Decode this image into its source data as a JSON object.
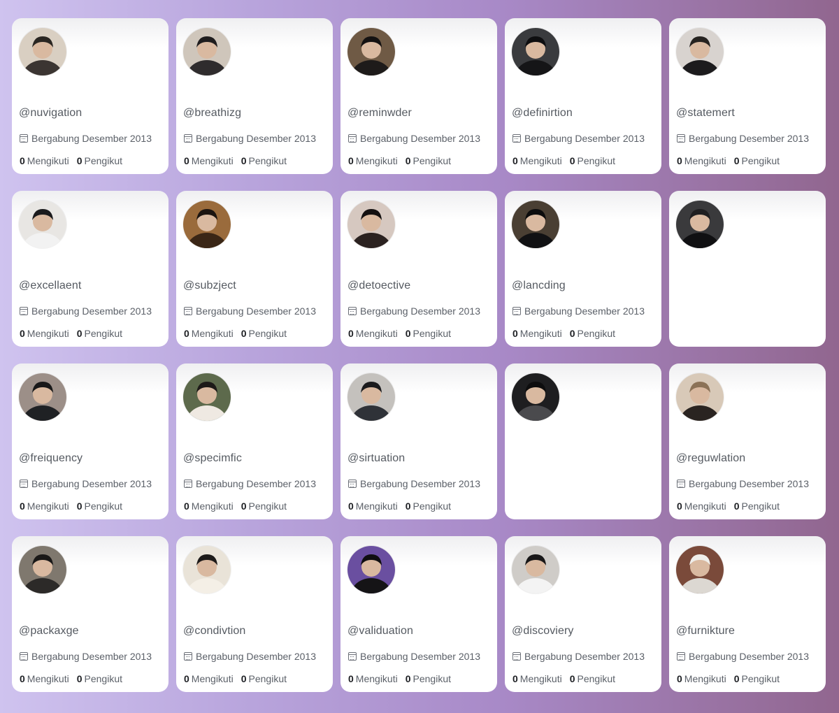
{
  "colors": {
    "background_start": "#cfc3ef",
    "background_end": "#91668f",
    "card": "#ffffff",
    "text": "#5b6068",
    "count": "#1d1f23"
  },
  "cards": [
    {
      "handle": "@nuvigation",
      "joined": "Bergabung Desember 2013",
      "following_count": "0",
      "following_label": "Mengikuti",
      "followers_count": "0",
      "followers_label": "Pengikut",
      "avatar": {
        "bg": "#d9cfc2",
        "fg": "#3b3532",
        "hair": "#2a2622"
      }
    },
    {
      "handle": "@breathizg",
      "joined": "Bergabung Desember 2013",
      "following_count": "0",
      "following_label": "Mengikuti",
      "followers_count": "0",
      "followers_label": "Pengikut",
      "avatar": {
        "bg": "#cfc6bb",
        "fg": "#2f2c2d",
        "hair": "#1f1d1e"
      }
    },
    {
      "handle": "@reminwder",
      "joined": "Bergabung Desember 2013",
      "following_count": "0",
      "following_label": "Mengikuti",
      "followers_count": "0",
      "followers_label": "Pengikut",
      "avatar": {
        "bg": "#6f5a45",
        "fg": "#1e1b1a",
        "hair": "#141212"
      }
    },
    {
      "handle": "@definirtion",
      "joined": "Bergabung Desember 2013",
      "following_count": "0",
      "following_label": "Mengikuti",
      "followers_count": "0",
      "followers_label": "Pengikut",
      "avatar": {
        "bg": "#3a3b3e",
        "fg": "#151517",
        "hair": "#0e0e10"
      }
    },
    {
      "handle": "@statemert",
      "joined": "Bergabung Desember 2013",
      "following_count": "0",
      "following_label": "Mengikuti",
      "followers_count": "0",
      "followers_label": "Pengikut",
      "avatar": {
        "bg": "#d8d3cf",
        "fg": "#1c1b1d",
        "hair": "#26221f"
      }
    },
    {
      "handle": "@excellaent",
      "joined": "Bergabung Desember 2013",
      "following_count": "0",
      "following_label": "Mengikuti",
      "followers_count": "0",
      "followers_label": "Pengikut",
      "avatar": {
        "bg": "#e8e6e3",
        "fg": "#f2f2f2",
        "hair": "#1a1a1c"
      }
    },
    {
      "handle": "@subzject",
      "joined": "Bergabung Desember 2013",
      "following_count": "0",
      "following_label": "Mengikuti",
      "followers_count": "0",
      "followers_label": "Pengikut",
      "avatar": {
        "bg": "#9a6b3c",
        "fg": "#3a2616",
        "hair": "#1b1410"
      }
    },
    {
      "handle": "@detoective",
      "joined": "Bergabung Desember 2013",
      "following_count": "0",
      "following_label": "Mengikuti",
      "followers_count": "0",
      "followers_label": "Pengikut",
      "avatar": {
        "bg": "#d6c8c0",
        "fg": "#2b2220",
        "hair": "#141010"
      }
    },
    {
      "handle": "@lancding",
      "joined": "Bergabung Desember 2013",
      "following_count": "0",
      "following_label": "Mengikuti",
      "followers_count": "0",
      "followers_label": "Pengikut",
      "avatar": {
        "bg": "#4a3f33",
        "fg": "#111113",
        "hair": "#0c0c0d"
      }
    },
    {
      "handle": "",
      "joined": "",
      "following_count": "",
      "following_label": "",
      "followers_count": "",
      "followers_label": "",
      "avatar": {
        "bg": "#3a3a3c",
        "fg": "#101012",
        "hair": "#1e1e20"
      }
    },
    {
      "handle": "@freiquency",
      "joined": "Bergabung Desember 2013",
      "following_count": "0",
      "following_label": "Mengikuti",
      "followers_count": "0",
      "followers_label": "Pengikut",
      "avatar": {
        "bg": "#9c8f88",
        "fg": "#1f2124",
        "hair": "#181819"
      }
    },
    {
      "handle": "@specimfic",
      "joined": "Bergabung Desember 2013",
      "following_count": "0",
      "following_label": "Mengikuti",
      "followers_count": "0",
      "followers_label": "Pengikut",
      "avatar": {
        "bg": "#5d6a4c",
        "fg": "#efe9e2",
        "hair": "#1d1a18"
      }
    },
    {
      "handle": "@sirtuation",
      "joined": "Bergabung Desember 2013",
      "following_count": "0",
      "following_label": "Mengikuti",
      "followers_count": "0",
      "followers_label": "Pengikut",
      "avatar": {
        "bg": "#c4c1bd",
        "fg": "#2f3238",
        "hair": "#1a1a1c"
      }
    },
    {
      "handle": "",
      "joined": "",
      "following_count": "",
      "following_label": "",
      "followers_count": "",
      "followers_label": "",
      "avatar": {
        "bg": "#1e1e20",
        "fg": "#4a4a4d",
        "hair": "#0d0d0e"
      }
    },
    {
      "handle": "@reguwlation",
      "joined": "Bergabung Desember 2013",
      "following_count": "0",
      "following_label": "Mengikuti",
      "followers_count": "0",
      "followers_label": "Pengikut",
      "avatar": {
        "bg": "#d8c9b8",
        "fg": "#2a2421",
        "hair": "#8b7257"
      }
    },
    {
      "handle": "@packaxge",
      "joined": "Bergabung Desember 2013",
      "following_count": "0",
      "following_label": "Mengikuti",
      "followers_count": "0",
      "followers_label": "Pengikut",
      "avatar": {
        "bg": "#7f786e",
        "fg": "#2c2a28",
        "hair": "#1a1918"
      }
    },
    {
      "handle": "@condivtion",
      "joined": "Bergabung Desember 2013",
      "following_count": "0",
      "following_label": "Mengikuti",
      "followers_count": "0",
      "followers_label": "Pengikut",
      "avatar": {
        "bg": "#e9e3d8",
        "fg": "#f4efe6",
        "hair": "#1d1a19"
      }
    },
    {
      "handle": "@validuation",
      "joined": "Bergabung Desember 2013",
      "following_count": "0",
      "following_label": "Mengikuti",
      "followers_count": "0",
      "followers_label": "Pengikut",
      "avatar": {
        "bg": "#6a4fa0",
        "fg": "#151416",
        "hair": "#0f0e10"
      }
    },
    {
      "handle": "@discoviery",
      "joined": "Bergabung Desember 2013",
      "following_count": "0",
      "following_label": "Mengikuti",
      "followers_count": "0",
      "followers_label": "Pengikut",
      "avatar": {
        "bg": "#cfccc8",
        "fg": "#f3f3f3",
        "hair": "#181718"
      }
    },
    {
      "handle": "@furnikture",
      "joined": "Bergabung Desember 2013",
      "following_count": "0",
      "following_label": "Mengikuti",
      "followers_count": "0",
      "followers_label": "Pengikut",
      "avatar": {
        "bg": "#7a4a3a",
        "fg": "#dcd8d2",
        "hair": "#efeeea"
      }
    }
  ]
}
